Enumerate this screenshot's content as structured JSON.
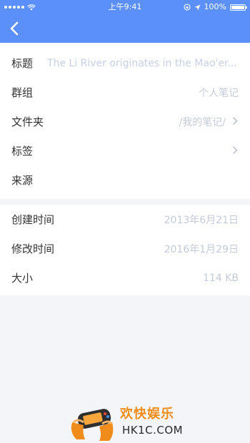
{
  "status_bar": {
    "time": "上午9:41",
    "battery": "100%"
  },
  "nav": {
    "back_icon": "chevron-left-icon"
  },
  "info_rows": [
    {
      "label": "标题",
      "value": "The Li River originates in the Mao'er..."
    },
    {
      "label": "群组",
      "value": "个人笔记"
    },
    {
      "label": "文件夹",
      "value": "/我的笔记/"
    },
    {
      "label": "标签",
      "value": ""
    },
    {
      "label": "来源",
      "value": ""
    }
  ],
  "meta_rows": [
    {
      "label": "创建时间",
      "value": "2013年6月21日"
    },
    {
      "label": "修改时间",
      "value": "2016年1月29日"
    },
    {
      "label": "大小",
      "value": "114 KB"
    }
  ],
  "watermark": {
    "title": "欢快娱乐",
    "subtitle": "HK1C.COM"
  },
  "colors": {
    "header": "#5b8ff9",
    "value_text": "#c4cbd8",
    "watermark": "#f08c1b"
  }
}
